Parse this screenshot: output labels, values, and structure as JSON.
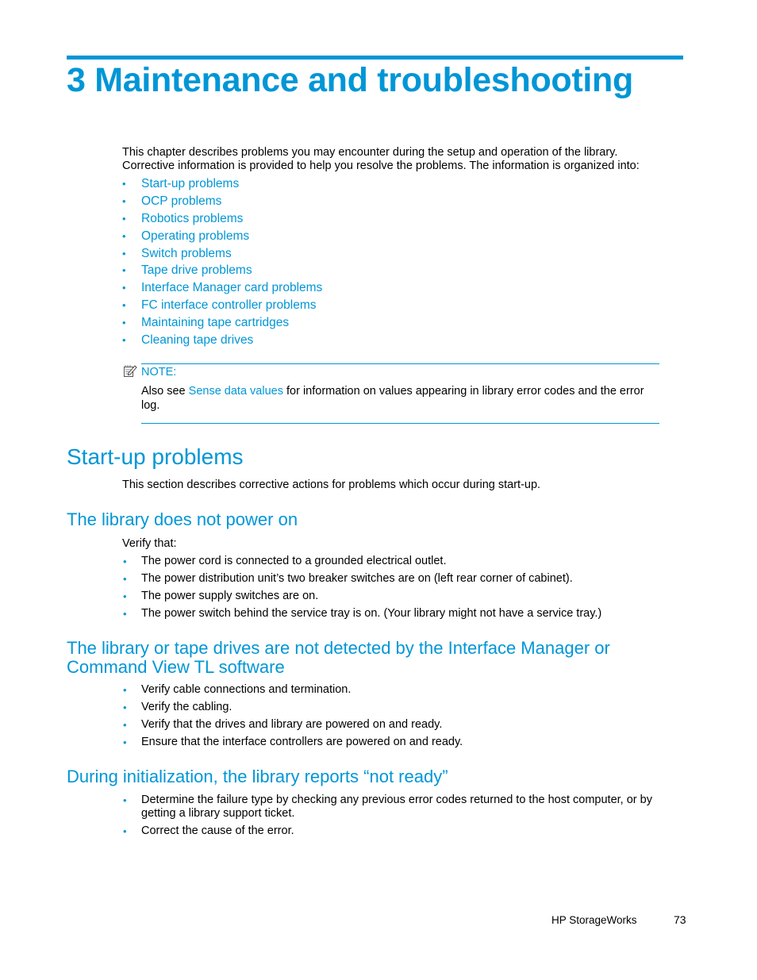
{
  "chapter": {
    "title": "3 Maintenance and troubleshooting",
    "intro": "This chapter describes problems you may encounter during the setup and operation of the library. Corrective information is provided to help you resolve the problems.  The information is organized into:",
    "toc": [
      "Start-up problems",
      "OCP problems",
      "Robotics problems",
      "Operating problems",
      "Switch problems",
      "Tape drive problems",
      "Interface Manager card problems",
      "FC interface controller problems",
      "Maintaining tape cartridges",
      "Cleaning tape drives"
    ],
    "bullet": "•"
  },
  "note": {
    "icon": "note-pad-icon",
    "label": "NOTE:",
    "text_before": "Also see ",
    "link": "Sense data values",
    "text_after": " for information on values appearing in library error codes and the error log."
  },
  "startup": {
    "title": "Start-up problems",
    "description": "This section describes corrective actions for problems which occur during start-up.",
    "power": {
      "title": "The library does not power on",
      "lead": "Verify that:",
      "items": [
        "The power cord is connected to a grounded electrical outlet.",
        "The power distribution unit’s two breaker switches are on (left rear corner of cabinet).",
        "The power supply switches are on.",
        "The power switch behind the service tray is on. (Your library might not have a service tray.)"
      ]
    },
    "detect": {
      "title": "The library or tape drives are not detected by the Interface Manager or Command View TL software",
      "items": [
        "Verify cable connections and termination.",
        "Verify the cabling.",
        "Verify that the drives and library are powered on and ready.",
        "Ensure that the interface controllers are powered on and ready."
      ]
    },
    "notready": {
      "title": "During initialization, the library reports “not ready”",
      "items": [
        "Determine the failure type by checking any previous error codes returned to the host computer, or by getting a library support ticket.",
        "Correct the cause of the error."
      ]
    }
  },
  "footer": {
    "brand": "HP StorageWorks",
    "page": "73"
  },
  "colors": {
    "accent": "#0096d6",
    "text": "#000000"
  }
}
